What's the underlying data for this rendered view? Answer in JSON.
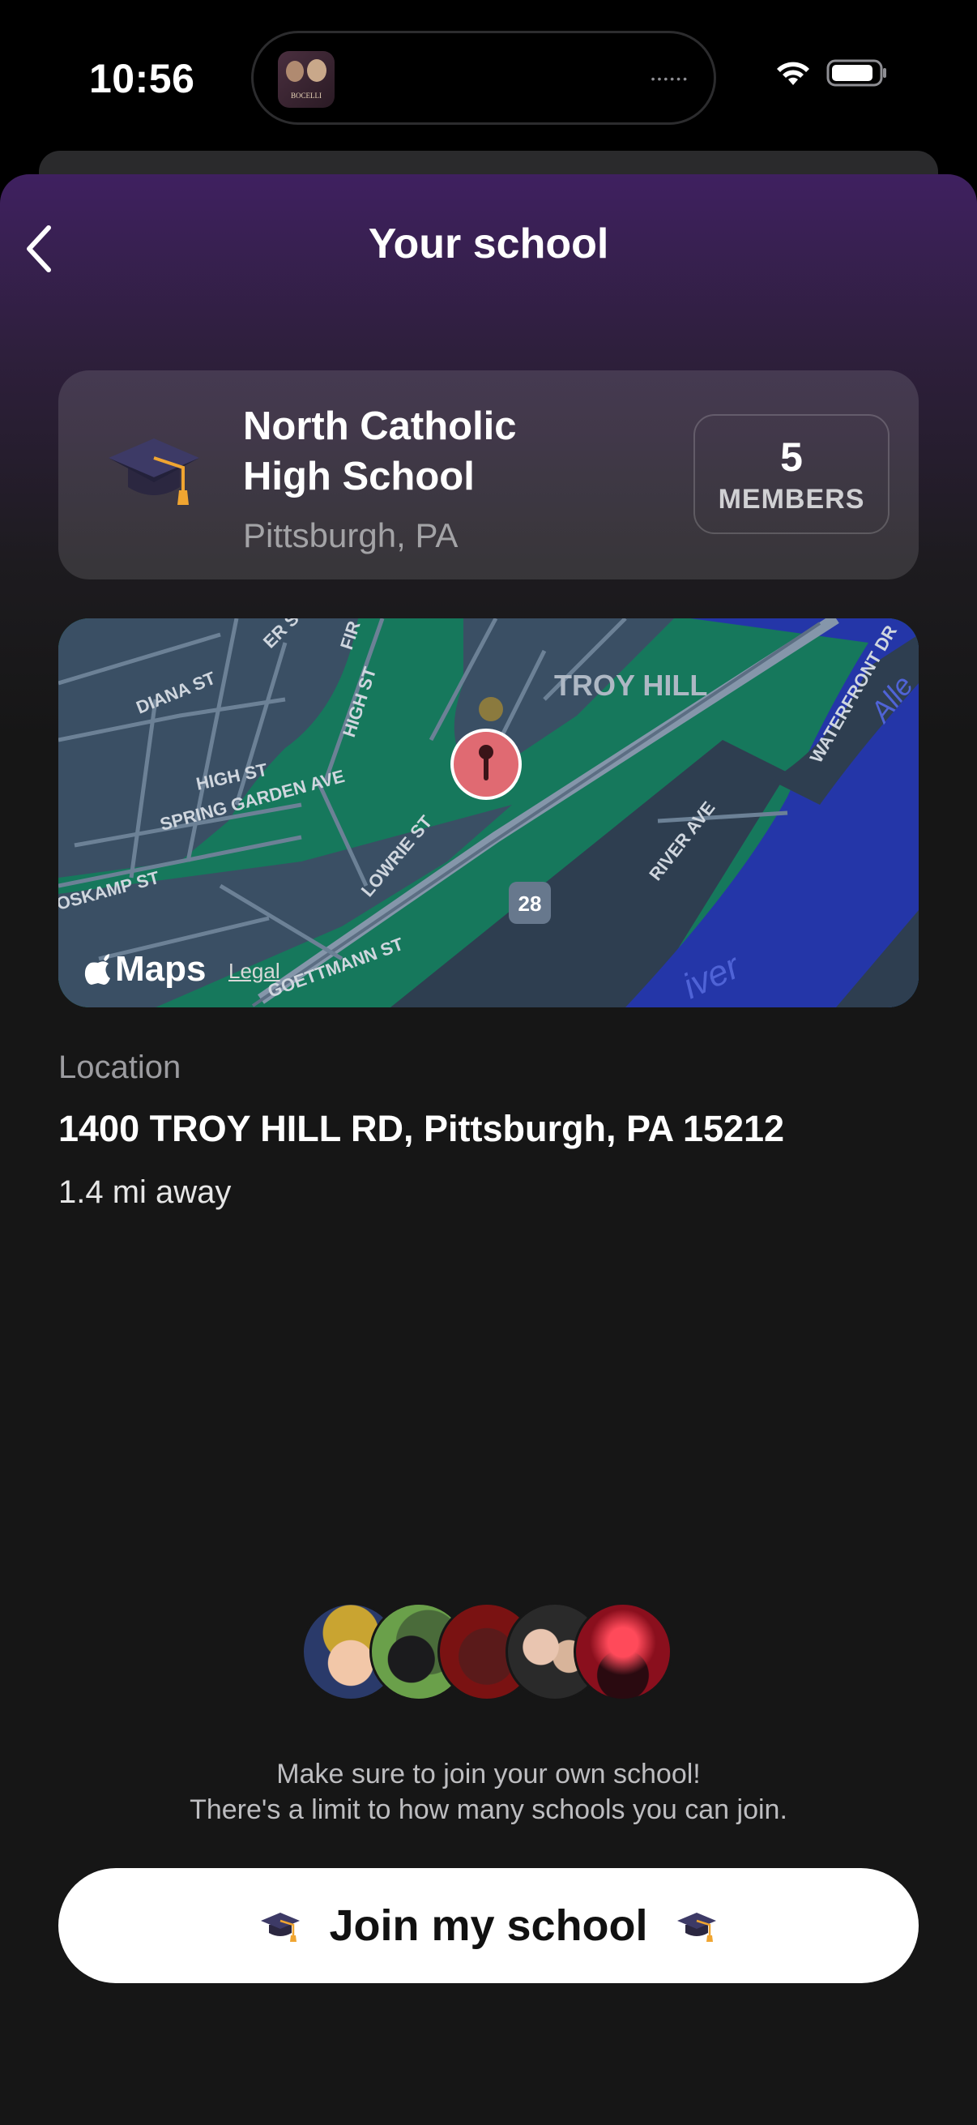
{
  "status_bar": {
    "time": "10:56",
    "now_playing_art_text": "BOCELLI",
    "wifi_icon": "wifi-icon",
    "battery_icon": "battery-icon"
  },
  "nav": {
    "title": "Your school",
    "back_icon": "chevron-left-icon"
  },
  "school": {
    "icon": "graduation-cap-icon",
    "name_line1": "North Catholic",
    "name_line2": "High School",
    "city": "Pittsburgh, PA",
    "members_count": "5",
    "members_label": "MEMBERS"
  },
  "map": {
    "neighborhood": "TROY HILL",
    "streets": [
      "DIANA ST",
      "HIGH ST",
      "SPRING GARDEN AVE",
      "LOWRIE ST",
      "RIVER AVE",
      "WATERFRONT DR",
      "OSKAMP ST",
      "GOETTMANN ST",
      "HIGH ST",
      "ER ST",
      "FIR"
    ],
    "route_number": "28",
    "river_label": "iver",
    "river_label2": "Alle",
    "logo_text": "Maps",
    "legal_text": "Legal",
    "pin_icon": "map-pin-icon"
  },
  "location": {
    "label": "Location",
    "address": "1400 TROY HILL RD, Pittsburgh, PA 15212",
    "distance": "1.4 mi away"
  },
  "members_avatars": [
    "avatar-1",
    "avatar-2",
    "avatar-3",
    "avatar-4",
    "avatar-5"
  ],
  "note": {
    "line1": "Make sure to join your own school!",
    "line2": "There's a limit to how many schools you can join."
  },
  "join_button": {
    "label": "Join my school",
    "icon": "graduation-cap-icon"
  },
  "colors": {
    "sheet_top": "#3f2060",
    "background": "#161616",
    "pin": "#e06a72",
    "map_land": "#16785c",
    "map_water": "#2436a8"
  }
}
